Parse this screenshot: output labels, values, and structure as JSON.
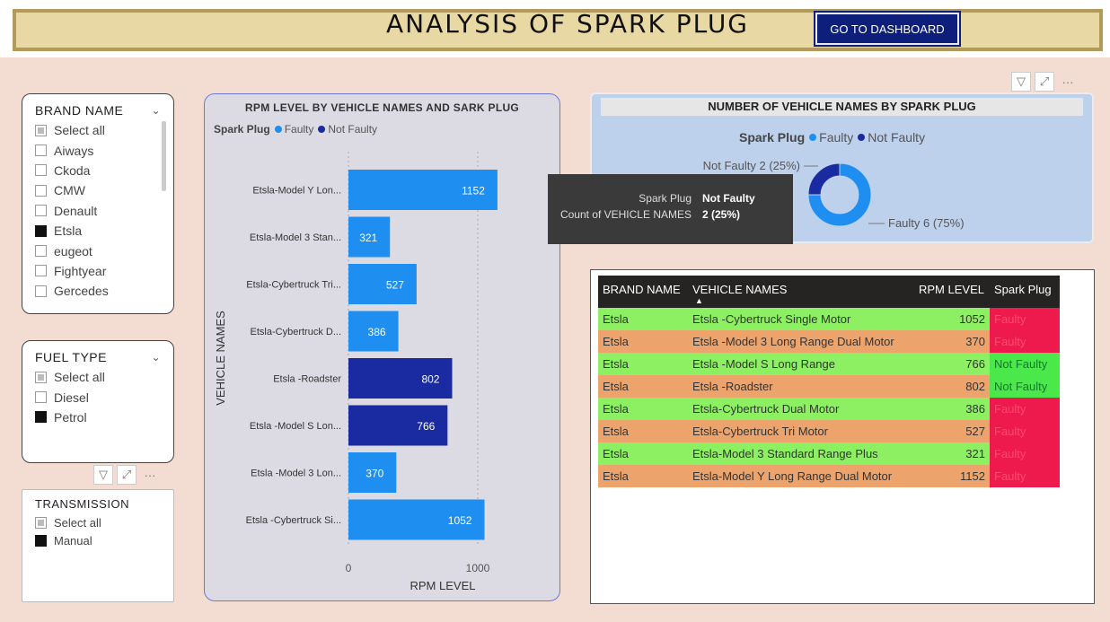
{
  "header": {
    "title": "ANALYSIS OF SPARK PLUG",
    "dashboard_button": "GO TO DASHBOARD"
  },
  "toolbar_icons": [
    "filter-icon",
    "focus-mode-icon",
    "more-options-icon"
  ],
  "toolbar_glyphs": {
    "filter": "▽",
    "focus": "⤢",
    "more": "···"
  },
  "brand_slicer": {
    "title": "BRAND NAME",
    "options": [
      {
        "label": "Select all",
        "state": "partial"
      },
      {
        "label": "Aiways",
        "state": "off"
      },
      {
        "label": "Ckoda",
        "state": "off"
      },
      {
        "label": "CMW",
        "state": "off"
      },
      {
        "label": "Denault",
        "state": "off"
      },
      {
        "label": "Etsla",
        "state": "on"
      },
      {
        "label": "eugeot",
        "state": "off"
      },
      {
        "label": "Fightyear",
        "state": "off"
      },
      {
        "label": "Gercedes",
        "state": "off"
      }
    ]
  },
  "fuel_slicer": {
    "title": "FUEL TYPE",
    "options": [
      {
        "label": "Select all",
        "state": "partial"
      },
      {
        "label": "Diesel",
        "state": "off"
      },
      {
        "label": "Petrol",
        "state": "on"
      }
    ]
  },
  "transmission_slicer": {
    "title": "TRANSMISSION",
    "options": [
      {
        "label": "Select all",
        "state": "partial"
      },
      {
        "label": "Manual",
        "state": "on"
      }
    ]
  },
  "colors": {
    "faulty": "#1e8ff0",
    "not_faulty": "#1a2aa0"
  },
  "chart_data": [
    {
      "type": "bar",
      "orientation": "horizontal",
      "title": "RPM LEVEL BY VEHICLE NAMES AND SARK PLUG",
      "legend_title": "Spark Plug",
      "legend": [
        "Faulty",
        "Not Faulty"
      ],
      "xlabel": "RPM LEVEL",
      "ylabel": "VEHICLE NAMES",
      "xlim": [
        0,
        1200
      ],
      "x_ticks": [
        0,
        1000
      ],
      "categories": [
        "Etsla-Model Y Lon...",
        "Etsla-Model 3 Stan...",
        "Etsla-Cybertruck Tri...",
        "Etsla-Cybertruck D...",
        "Etsla -Roadster",
        "Etsla -Model S Lon...",
        "Etsla -Model 3 Lon...",
        "Etsla -Cybertruck Si..."
      ],
      "values": [
        1152,
        321,
        527,
        386,
        802,
        766,
        370,
        1052
      ],
      "series_of_bar": [
        "Faulty",
        "Faulty",
        "Faulty",
        "Faulty",
        "Not Faulty",
        "Not Faulty",
        "Faulty",
        "Faulty"
      ]
    },
    {
      "type": "pie",
      "variant": "donut",
      "title": "NUMBER OF VEHICLE NAMES BY SPARK PLUG",
      "legend_title": "Spark Plug",
      "labels": [
        "Faulty",
        "Not Faulty"
      ],
      "values": [
        6,
        2
      ],
      "data_labels": [
        "Faulty 6 (75%)",
        "Not Faulty 2 (25%)"
      ]
    }
  ],
  "tooltip": {
    "k1": "Spark Plug",
    "v1": "Not Faulty",
    "k2": "Count of VEHICLE NAMES",
    "v2": "2 (25%)"
  },
  "table": {
    "headers": [
      "BRAND NAME",
      "VEHICLE NAMES",
      "RPM LEVEL",
      "Spark Plug"
    ],
    "sort_indicator": "▲",
    "rows": [
      {
        "brand": "Etsla",
        "vehicle": "Etsla -Cybertruck Single Motor",
        "rpm": 1052,
        "plug": "Faulty",
        "color": "g"
      },
      {
        "brand": "Etsla",
        "vehicle": "Etsla -Model 3 Long Range Dual Motor",
        "rpm": 370,
        "plug": "Faulty",
        "color": "o"
      },
      {
        "brand": "Etsla",
        "vehicle": "Etsla -Model S Long Range",
        "rpm": 766,
        "plug": "Not Faulty",
        "color": "g"
      },
      {
        "brand": "Etsla",
        "vehicle": "Etsla -Roadster",
        "rpm": 802,
        "plug": "Not Faulty",
        "color": "o"
      },
      {
        "brand": "Etsla",
        "vehicle": "Etsla-Cybertruck Dual Motor",
        "rpm": 386,
        "plug": "Faulty",
        "color": "g"
      },
      {
        "brand": "Etsla",
        "vehicle": "Etsla-Cybertruck Tri Motor",
        "rpm": 527,
        "plug": "Faulty",
        "color": "o"
      },
      {
        "brand": "Etsla",
        "vehicle": "Etsla-Model 3 Standard Range Plus",
        "rpm": 321,
        "plug": "Faulty",
        "color": "g"
      },
      {
        "brand": "Etsla",
        "vehicle": "Etsla-Model Y Long Range Dual Motor",
        "rpm": 1152,
        "plug": "Faulty",
        "color": "o"
      }
    ]
  }
}
